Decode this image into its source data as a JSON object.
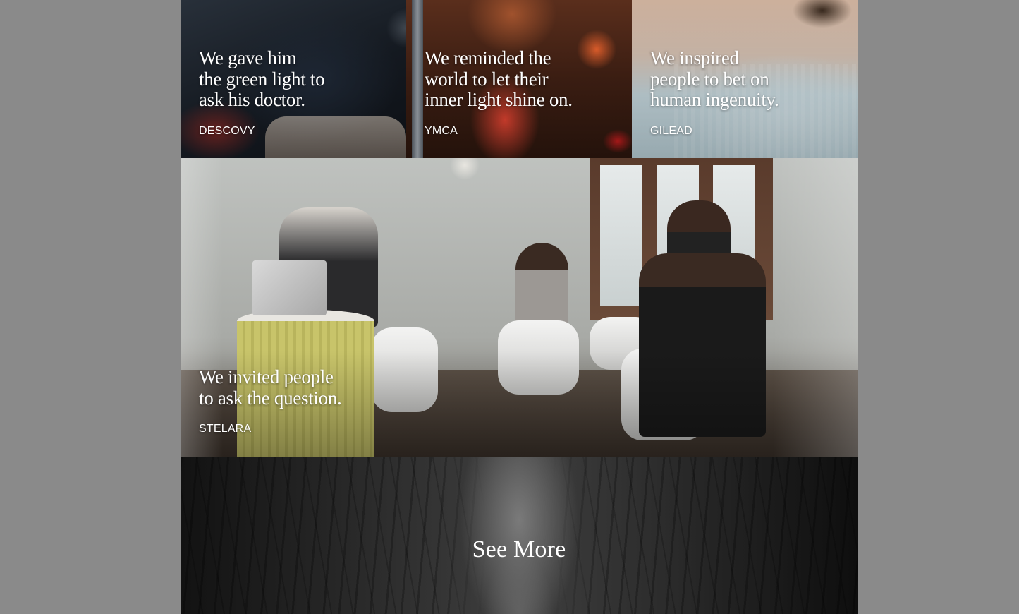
{
  "tiles": [
    {
      "headline": "We gave him\nthe green light to\nask his doctor.",
      "client": "DESCOVY"
    },
    {
      "headline": "We reminded the\nworld to let their\ninner light shine on.",
      "client": "YMCA"
    },
    {
      "headline": "We inspired\npeople to bet on\nhuman ingenuity.",
      "client": "GILEAD"
    },
    {
      "headline": "We invited people\nto ask the question.",
      "client": "STELARA"
    }
  ],
  "see_more": {
    "label": "See More"
  },
  "colors": {
    "page_background": "#8a8a8a",
    "caption_text": "#ffffff"
  }
}
